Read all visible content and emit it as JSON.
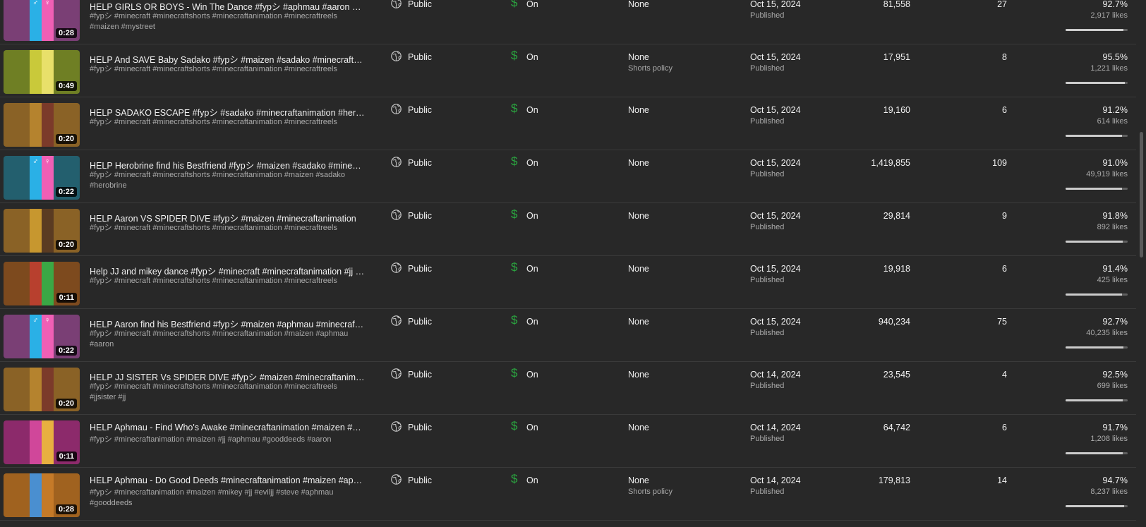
{
  "colors": {
    "background": "#282828",
    "monetize_green": "#2ba640",
    "secondary_text": "#aaaaaa"
  },
  "rows": [
    {
      "duration": "0:28",
      "thumb": [
        "#7a3f75",
        "#2ab0e6",
        "#f05fb5",
        "#7a3f75"
      ],
      "symbols": [
        "♂",
        "♀"
      ],
      "title": "HELP GIRLS OR BOYS - Win The Dance #fypシ #aphmau #aaron #jj #jjsister",
      "desc": "#fypシ #minecraft #minecraftshorts #minecraftanimation #minecraftreels #maizen #mystreet",
      "visibility": "Public",
      "monetization": "On",
      "restrictions": "None",
      "restrictions_sub": "",
      "date": "Oct 15, 2024",
      "status": "Published",
      "views": "81,558",
      "comments": "27",
      "likes_pct": "92.7%",
      "likes": "2,917 likes",
      "ratio": 0.927
    },
    {
      "duration": "0:49",
      "thumb": [
        "#6f7f24",
        "#c9c93a",
        "#e8e06a",
        "#6f7f24"
      ],
      "symbols": [],
      "title": "HELP And SAVE Baby Sadako #fypシ #maizen #sadako #minecraftanimation",
      "desc": "#fypシ #minecraft #minecraftshorts #minecraftanimation #minecraftreels",
      "visibility": "Public",
      "monetization": "On",
      "restrictions": "None",
      "restrictions_sub": "Shorts policy",
      "date": "Oct 15, 2024",
      "status": "Published",
      "views": "17,951",
      "comments": "8",
      "likes_pct": "95.5%",
      "likes": "1,221 likes",
      "ratio": 0.955
    },
    {
      "duration": "0:20",
      "thumb": [
        "#8a6226",
        "#b5832e",
        "#7b3a2a",
        "#8a6226"
      ],
      "symbols": [],
      "title": "HELP SADAKO ESCAPE #fypシ #sadako #minecraftanimation #herobrine #maizen",
      "desc": "#fypシ #minecraft #minecraftshorts #minecraftanimation #minecraftreels",
      "visibility": "Public",
      "monetization": "On",
      "restrictions": "None",
      "restrictions_sub": "",
      "date": "Oct 15, 2024",
      "status": "Published",
      "views": "19,160",
      "comments": "6",
      "likes_pct": "91.2%",
      "likes": "614 likes",
      "ratio": 0.912
    },
    {
      "duration": "0:22",
      "thumb": [
        "#235f6e",
        "#2ab0e6",
        "#f05fb5",
        "#235f6e"
      ],
      "symbols": [
        "♂",
        "♀"
      ],
      "title": "HELP Herobrine find his Bestfriend #fypシ #maizen #sadako #minecraftanimation",
      "desc": "#fypシ #minecraft #minecraftshorts #minecraftanimation #maizen #sadako #herobrine",
      "visibility": "Public",
      "monetization": "On",
      "restrictions": "None",
      "restrictions_sub": "",
      "date": "Oct 15, 2024",
      "status": "Published",
      "views": "1,419,855",
      "comments": "109",
      "likes_pct": "91.0%",
      "likes": "49,919 likes",
      "ratio": 0.91
    },
    {
      "duration": "0:20",
      "thumb": [
        "#8a6226",
        "#c7972f",
        "#5a3b22",
        "#8a6226"
      ],
      "symbols": [],
      "title": "HELP Aaron VS SPIDER DIVE #fypシ #maizen #minecraftanimation",
      "desc": "#fypシ #minecraft #minecraftshorts #minecraftanimation #minecraftreels",
      "visibility": "Public",
      "monetization": "On",
      "restrictions": "None",
      "restrictions_sub": "",
      "date": "Oct 15, 2024",
      "status": "Published",
      "views": "29,814",
      "comments": "9",
      "likes_pct": "91.8%",
      "likes": "892 likes",
      "ratio": 0.918
    },
    {
      "duration": "0:11",
      "thumb": [
        "#7d4a1e",
        "#b8402e",
        "#3aa845",
        "#7d4a1e"
      ],
      "symbols": [],
      "title": "Help JJ and mikey dance #fypシ #minecraft #minecraftanimation #jj #jjsister",
      "desc": "#fypシ #minecraft #minecraftshorts #minecraftanimation #minecraftreels",
      "visibility": "Public",
      "monetization": "On",
      "restrictions": "None",
      "restrictions_sub": "",
      "date": "Oct 15, 2024",
      "status": "Published",
      "views": "19,918",
      "comments": "6",
      "likes_pct": "91.4%",
      "likes": "425 likes",
      "ratio": 0.914
    },
    {
      "duration": "0:22",
      "thumb": [
        "#7a3f75",
        "#2ab0e6",
        "#f05fb5",
        "#7a3f75"
      ],
      "symbols": [
        "♂",
        "♀"
      ],
      "title": "HELP Aaron find his Bestfriend #fypシ #maizen #aphmau #minecraftanimation",
      "desc": "#fypシ #minecraft #minecraftshorts #minecraftanimation #maizen #aphmau #aaron",
      "visibility": "Public",
      "monetization": "On",
      "restrictions": "None",
      "restrictions_sub": "",
      "date": "Oct 15, 2024",
      "status": "Published",
      "views": "940,234",
      "comments": "75",
      "likes_pct": "92.7%",
      "likes": "40,235 likes",
      "ratio": 0.927
    },
    {
      "duration": "0:20",
      "thumb": [
        "#8a6226",
        "#b5832e",
        "#7b3a2a",
        "#8a6226"
      ],
      "symbols": [],
      "title": "HELP JJ SISTER Vs SPIDER DIVE #fypシ #maizen #minecraftanimation",
      "desc": "#fypシ #minecraft #minecraftshorts #minecraftanimation #minecraftreels #jjsister #jj",
      "visibility": "Public",
      "monetization": "On",
      "restrictions": "None",
      "restrictions_sub": "",
      "date": "Oct 14, 2024",
      "status": "Published",
      "views": "23,545",
      "comments": "4",
      "likes_pct": "92.5%",
      "likes": "699 likes",
      "ratio": 0.925
    },
    {
      "duration": "0:11",
      "thumb": [
        "#8c2a6b",
        "#d0479a",
        "#e8b040",
        "#8c2a6b"
      ],
      "symbols": [],
      "title": "HELP Aphmau - Find Who's Awake #minecraftanimation #maizen #aphmau",
      "desc": "#fypシ #minecraftanimation #maizen #jj #aphmau #gooddeeds #aaron",
      "visibility": "Public",
      "monetization": "On",
      "restrictions": "None",
      "restrictions_sub": "",
      "date": "Oct 14, 2024",
      "status": "Published",
      "views": "64,742",
      "comments": "6",
      "likes_pct": "91.7%",
      "likes": "1,208 likes",
      "ratio": 0.917
    },
    {
      "duration": "0:28",
      "thumb": [
        "#a0621f",
        "#4a8fd0",
        "#c57a28",
        "#a0621f"
      ],
      "symbols": [],
      "title": "HELP Aphmau - Do Good Deeds #minecraftanimation #maizen #aphmau #jj",
      "desc": "#fypシ #minecraftanimation #maizen #mikey #jj #eviljj #steve #aphmau #gooddeeds",
      "visibility": "Public",
      "monetization": "On",
      "restrictions": "None",
      "restrictions_sub": "Shorts policy",
      "date": "Oct 14, 2024",
      "status": "Published",
      "views": "179,813",
      "comments": "14",
      "likes_pct": "94.7%",
      "likes": "8,237 likes",
      "ratio": 0.947
    }
  ]
}
